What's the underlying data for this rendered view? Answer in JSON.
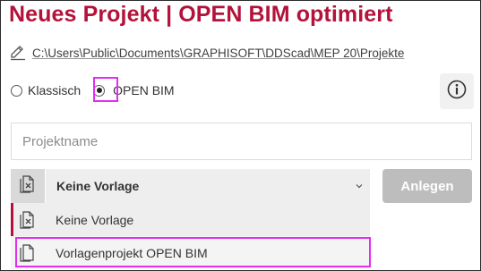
{
  "header": {
    "title": "Neues Projekt | OPEN BIM optimiert"
  },
  "path": {
    "icon": "edit-pencil-icon",
    "text": "C:\\Users\\Public\\Documents\\GRAPHISOFT\\DDScad\\MEP 20\\Projekte"
  },
  "mode": {
    "options": [
      {
        "label": "Klassisch",
        "selected": false
      },
      {
        "label": "OPEN BIM",
        "selected": true
      }
    ]
  },
  "info": {
    "icon": "info-icon"
  },
  "project_name": {
    "placeholder": "Projektname",
    "value": ""
  },
  "template": {
    "selected_label": "Keine Vorlage",
    "options": [
      {
        "label": "Keine Vorlage",
        "icon": "no-template-icon"
      },
      {
        "label": "Vorlagenprojekt OPEN BIM",
        "icon": "template-document-icon"
      }
    ]
  },
  "actions": {
    "create_label": "Anlegen"
  },
  "colors": {
    "accent": "#b3123a",
    "highlight": "#e22ef0",
    "button_disabled": "#bdbdbd"
  }
}
